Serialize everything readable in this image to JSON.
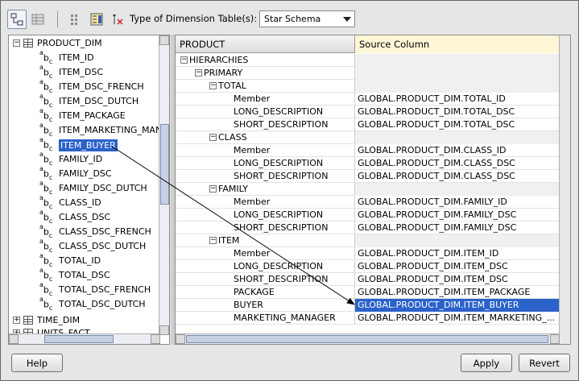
{
  "toolbar": {
    "dimension_label": "Type of Dimension Table(s):",
    "dimension_value": "Star Schema"
  },
  "tree": {
    "root": "PRODUCT_DIM",
    "columns": [
      "ITEM_ID",
      "ITEM_DSC",
      "ITEM_DSC_FRENCH",
      "ITEM_DSC_DUTCH",
      "ITEM_PACKAGE",
      "ITEM_MARKETING_MAN",
      "ITEM_BUYER",
      "FAMILY_ID",
      "FAMILY_DSC",
      "FAMILY_DSC_DUTCH",
      "CLASS_ID",
      "CLASS_DSC",
      "CLASS_DSC_FRENCH",
      "CLASS_DSC_DUTCH",
      "TOTAL_ID",
      "TOTAL_DSC",
      "TOTAL_DSC_FRENCH",
      "TOTAL_DSC_DUTCH"
    ],
    "selected": "ITEM_BUYER",
    "other_tables": [
      "TIME_DIM",
      "UNITS_FACT"
    ]
  },
  "grid": {
    "headers": {
      "col1": "PRODUCT",
      "col2": "Source Column"
    },
    "rows": [
      {
        "label": "HIERARCHIES",
        "value": ""
      },
      {
        "label": "PRIMARY",
        "value": ""
      },
      {
        "label": "TOTAL",
        "value": ""
      },
      {
        "label": "Member",
        "value": "GLOBAL.PRODUCT_DIM.TOTAL_ID"
      },
      {
        "label": "LONG_DESCRIPTION",
        "value": "GLOBAL.PRODUCT_DIM.TOTAL_DSC"
      },
      {
        "label": "SHORT_DESCRIPTION",
        "value": "GLOBAL.PRODUCT_DIM.TOTAL_DSC"
      },
      {
        "label": "CLASS",
        "value": ""
      },
      {
        "label": "Member",
        "value": "GLOBAL.PRODUCT_DIM.CLASS_ID"
      },
      {
        "label": "LONG_DESCRIPTION",
        "value": "GLOBAL.PRODUCT_DIM.CLASS_DSC"
      },
      {
        "label": "SHORT_DESCRIPTION",
        "value": "GLOBAL.PRODUCT_DIM.CLASS_DSC"
      },
      {
        "label": "FAMILY",
        "value": ""
      },
      {
        "label": "Member",
        "value": "GLOBAL.PRODUCT_DIM.FAMILY_ID"
      },
      {
        "label": "LONG_DESCRIPTION",
        "value": "GLOBAL.PRODUCT_DIM.FAMILY_DSC"
      },
      {
        "label": "SHORT_DESCRIPTION",
        "value": "GLOBAL.PRODUCT_DIM.FAMILY_DSC"
      },
      {
        "label": "ITEM",
        "value": ""
      },
      {
        "label": "Member",
        "value": "GLOBAL.PRODUCT_DIM.ITEM_ID"
      },
      {
        "label": "LONG_DESCRIPTION",
        "value": "GLOBAL.PRODUCT_DIM.ITEM_DSC"
      },
      {
        "label": "SHORT_DESCRIPTION",
        "value": "GLOBAL.PRODUCT_DIM.ITEM_DSC"
      },
      {
        "label": "PACKAGE",
        "value": "GLOBAL.PRODUCT_DIM.ITEM_PACKAGE"
      },
      {
        "label": "BUYER",
        "value": "GLOBAL.PRODUCT_DIM.ITEM_BUYER"
      },
      {
        "label": "MARKETING_MANAGER",
        "value": "GLOBAL.PRODUCT_DIM.ITEM_MARKETING_..."
      }
    ]
  },
  "buttons": {
    "help": "Help",
    "apply": "Apply",
    "revert": "Revert"
  },
  "colors": {
    "selection": "#2a62c9"
  }
}
